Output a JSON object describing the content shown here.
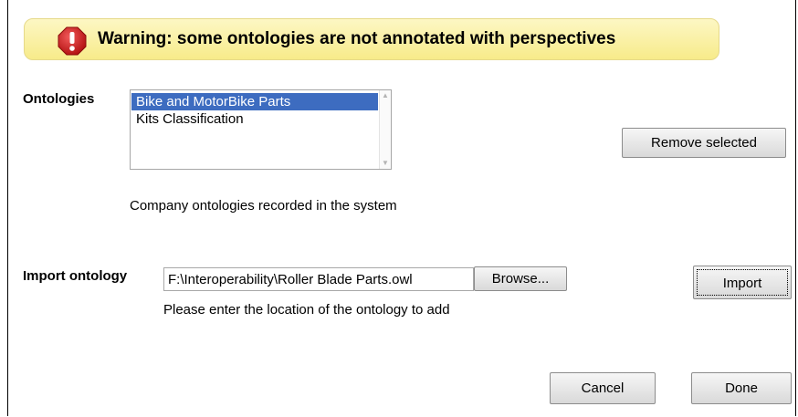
{
  "warning": {
    "text": "Warning: some ontologies are not annotated with perspectives",
    "icon": "warning-exclamation-icon"
  },
  "ontologies": {
    "label": "Ontologies",
    "items": [
      "Bike and MotorBike Parts",
      "Kits Classification"
    ],
    "selected_item": "Bike and MotorBike Parts",
    "remove_button": "Remove selected",
    "description": "Company ontologies recorded in the system"
  },
  "import": {
    "label": "Import ontology",
    "path_value": "F:\\Interoperability\\Roller Blade Parts.owl",
    "browse_button": "Browse...",
    "import_button": "Import",
    "hint": "Please enter the location of the ontology to add"
  },
  "footer": {
    "cancel_button": "Cancel",
    "done_button": "Done"
  },
  "colors": {
    "selection": "#3d6cc0",
    "warning_background": "#f9ef9e",
    "warning_icon": "#d61f1f"
  }
}
